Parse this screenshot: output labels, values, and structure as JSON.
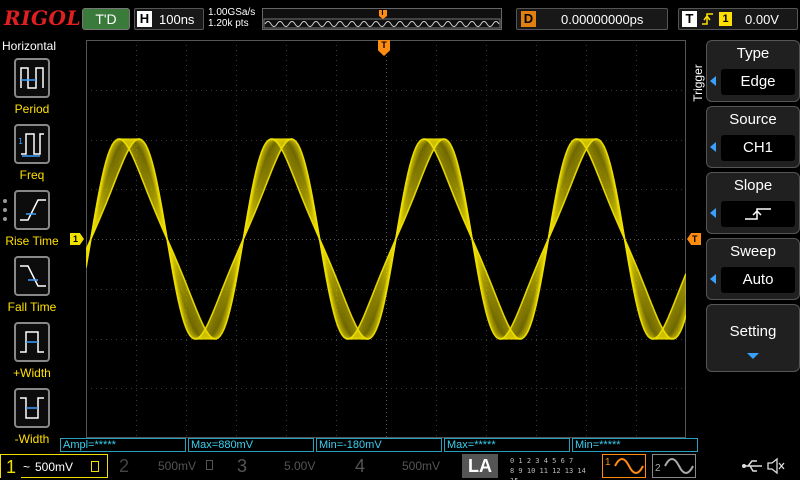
{
  "brand": "RIGOL",
  "top": {
    "run_status": "T'D",
    "horizontal_letter": "H",
    "timebase": "100ns",
    "sample_rate": "1.00GSa/s",
    "memory_depth": "1.20k pts",
    "trigger_marker": "T",
    "delay_letter": "D",
    "delay_value": "0.00000000ps",
    "trigger_letter": "T",
    "trigger_source": "1",
    "trigger_level": "0.00V"
  },
  "left_panel": {
    "title": "Horizontal",
    "items": [
      {
        "label": "Period"
      },
      {
        "label": "Freq"
      },
      {
        "label": "Rise Time"
      },
      {
        "label": "Fall Time"
      },
      {
        "label": "+Width"
      },
      {
        "label": "-Width"
      }
    ]
  },
  "markers": {
    "ch1_marker": "1",
    "trigger_top": "T",
    "trigger_level": "T"
  },
  "right_menu": {
    "title": "Trigger",
    "buttons": [
      {
        "title": "Type",
        "value": "Edge"
      },
      {
        "title": "Source",
        "value": "CH1"
      },
      {
        "title": "Slope",
        "value": ""
      },
      {
        "title": "Sweep",
        "value": "Auto"
      }
    ],
    "setting_label": "Setting"
  },
  "measurements": [
    "Ampl=*****",
    "Max=880mV",
    "Min=-180mV",
    "Max=*****",
    "Min=*****"
  ],
  "bottom": {
    "ch1": {
      "num": "1",
      "coupling": "~",
      "scale": "500mV"
    },
    "ch2": {
      "num": "2",
      "scale": "500mV"
    },
    "ch3": {
      "num": "3",
      "scale": "5.00V"
    },
    "ch4": {
      "num": "4",
      "scale": "500mV"
    },
    "la": "LA",
    "la_rows": [
      "0 1 2 3  4 5 6 7",
      "8 9 10 11  12 13 14 15"
    ],
    "gen1": "1",
    "gen2": "2"
  },
  "colors": {
    "ch1": "#f0e000",
    "ch2": "#22d0f0",
    "ch3": "#e040e0",
    "ch4": "#3070ff",
    "trigger": "#ff8c10",
    "measure_text": "#3ad0f0"
  }
}
